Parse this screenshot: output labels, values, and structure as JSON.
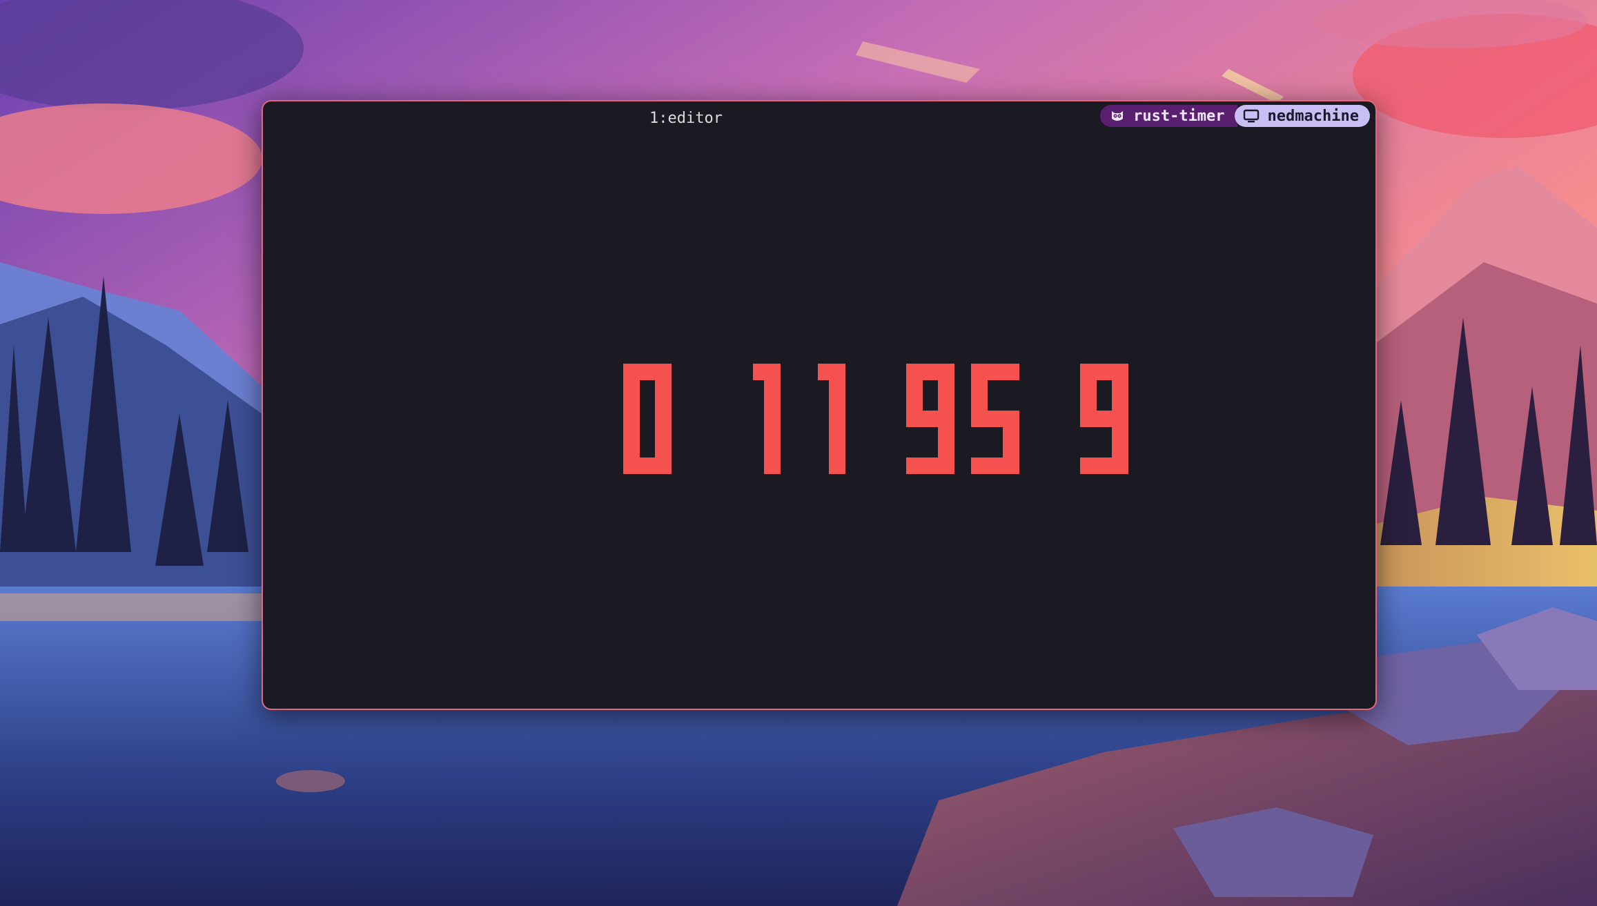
{
  "terminal": {
    "tab_title": "1:editor",
    "session_name": "rust-timer",
    "session_icon": "owl-icon",
    "host_name": "nedmachine",
    "host_icon": "monitor-icon"
  },
  "timer": {
    "hours": "01",
    "minutes": "19",
    "seconds": "59",
    "color": "#f5514f"
  },
  "colors": {
    "window_bg": "#1b1a23",
    "window_border": "#e0697c",
    "session_pill": "#5a1f6e",
    "host_pill": "#c9bff5"
  }
}
